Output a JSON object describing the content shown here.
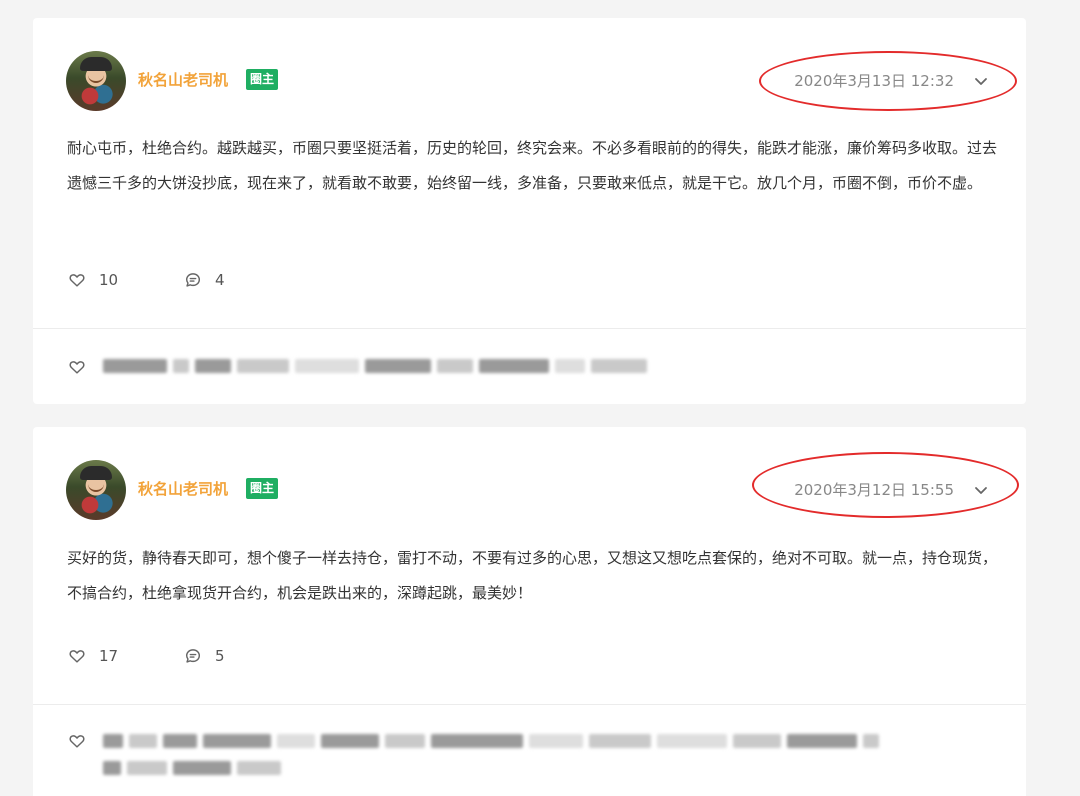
{
  "posts": [
    {
      "author": "秋名山老司机",
      "badge": "圈主",
      "timestamp": "2020年3月13日 12:32",
      "content": "耐心屯币，杜绝合约。越跌越买，币圈只要坚挺活着，历史的轮回，终究会来。不必多看眼前的的得失，能跌才能涨，廉价筹码多收取。过去遗憾三千多的大饼没抄底，现在来了，就看敢不敢要，始终留一线，多准备，只要敢来低点，就是干它。放几个月，币圈不倒，币价不虚。",
      "likes": "10",
      "comments": "4"
    },
    {
      "author": "秋名山老司机",
      "badge": "圈主",
      "timestamp": "2020年3月12日 15:55",
      "content": "买好的货，静待春天即可，想个傻子一样去持仓，雷打不动，不要有过多的心思，又想这又想吃点套保的，绝对不可取。就一点，持仓现货，不搞合约，杜绝拿现货开合约，机会是跌出来的，深蹲起跳，最美妙！",
      "likes": "17",
      "comments": "5"
    }
  ],
  "icons": {
    "like": "heart-outline-icon",
    "comment": "comment-bubble-icon",
    "expand": "chevron-down-icon"
  },
  "colors": {
    "author": "#f2a33a",
    "badge_bg": "#1fae62",
    "highlight_ellipse": "#e32b2b",
    "timestamp": "#888888"
  }
}
